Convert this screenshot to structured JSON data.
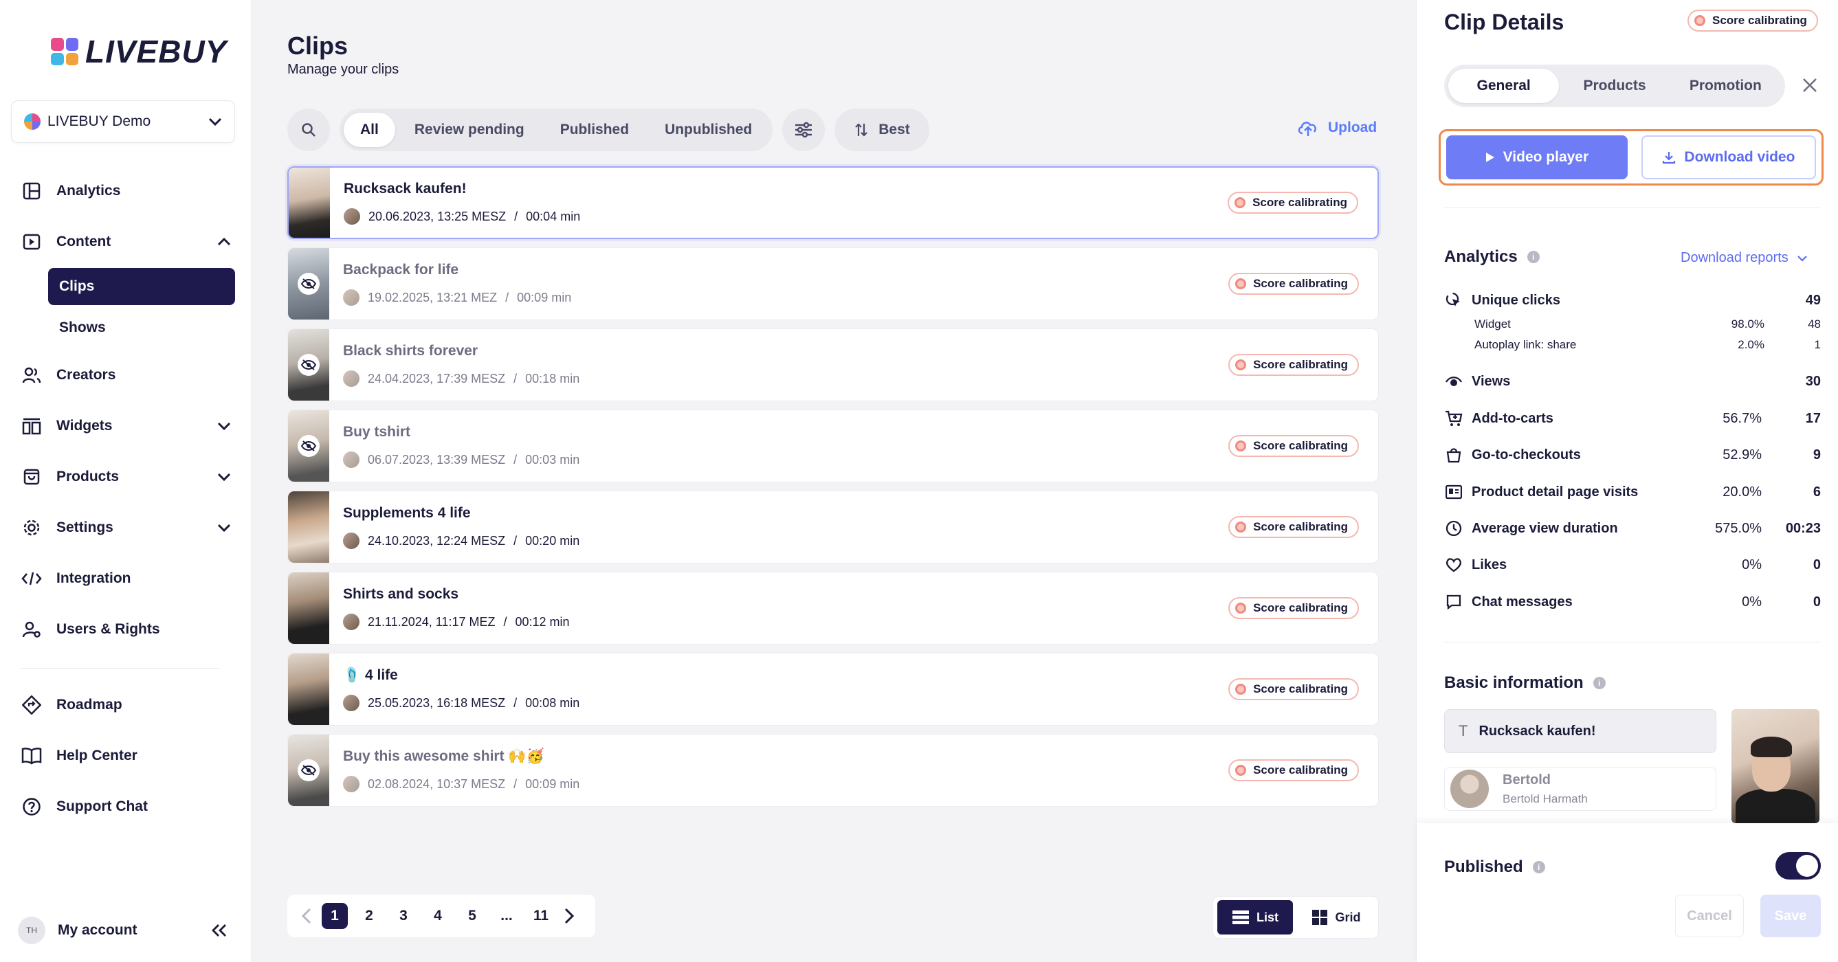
{
  "brand": {
    "name": "LIVEBUY"
  },
  "sidebar": {
    "org": "LIVEBUY Demo",
    "items": [
      {
        "label": "Analytics",
        "icon": "analytics-icon"
      },
      {
        "label": "Content",
        "icon": "content-icon"
      },
      {
        "label": "Creators",
        "icon": "creators-icon"
      },
      {
        "label": "Widgets",
        "icon": "widgets-icon"
      },
      {
        "label": "Products",
        "icon": "products-icon"
      },
      {
        "label": "Settings",
        "icon": "settings-icon"
      },
      {
        "label": "Integration",
        "icon": "code-icon"
      },
      {
        "label": "Users & Rights",
        "icon": "users-icon"
      },
      {
        "label": "Roadmap",
        "icon": "roadmap-icon"
      },
      {
        "label": "Help Center",
        "icon": "book-icon"
      },
      {
        "label": "Support Chat",
        "icon": "question-icon"
      }
    ],
    "sub_items": [
      {
        "label": "Clips"
      },
      {
        "label": "Shows"
      }
    ],
    "account": {
      "initials": "TH",
      "label": "My account"
    }
  },
  "main": {
    "title": "Clips",
    "subtitle": "Manage your clips",
    "filters": [
      "All",
      "Review pending",
      "Published",
      "Unpublished"
    ],
    "sort_label": "Best",
    "upload_label": "Upload",
    "clips": [
      {
        "title": "Rucksack kaufen!",
        "date": "20.06.2023, 13:25 MESZ",
        "sep": "/",
        "duration": "00:04 min",
        "badge": "Score calibrating"
      },
      {
        "title": "Backpack for life",
        "date": "19.02.2025, 13:21 MEZ",
        "sep": "/",
        "duration": "00:09 min",
        "badge": "Score calibrating"
      },
      {
        "title": "Black shirts forever",
        "date": "24.04.2023, 17:39 MESZ",
        "sep": "/",
        "duration": "00:18 min",
        "badge": "Score calibrating"
      },
      {
        "title": "Buy tshirt",
        "date": "06.07.2023, 13:39 MESZ",
        "sep": "/",
        "duration": "00:03 min",
        "badge": "Score calibrating"
      },
      {
        "title": "Supplements 4 life",
        "date": "24.10.2023, 12:24 MESZ",
        "sep": "/",
        "duration": "00:20 min",
        "badge": "Score calibrating"
      },
      {
        "title": "Shirts and socks",
        "date": "21.11.2024, 11:17 MEZ",
        "sep": "/",
        "duration": "00:12 min",
        "badge": "Score calibrating"
      },
      {
        "title": "🩴 4 life",
        "date": "25.05.2023, 16:18 MESZ",
        "sep": "/",
        "duration": "00:08 min",
        "badge": "Score calibrating"
      },
      {
        "title": "Buy this awesome shirt 🙌🥳",
        "date": "02.08.2024, 10:37 MESZ",
        "sep": "/",
        "duration": "00:09 min",
        "badge": "Score calibrating"
      }
    ],
    "pagination": [
      "1",
      "2",
      "3",
      "4",
      "5",
      "...",
      "11"
    ],
    "view": {
      "list": "List",
      "grid": "Grid"
    }
  },
  "panel": {
    "title": "Clip Details",
    "badge": "Score calibrating",
    "tabs": [
      "General",
      "Products",
      "Promotion"
    ],
    "video_player": "Video player",
    "download_video": "Download video",
    "analytics_title": "Analytics",
    "download_reports": "Download reports",
    "metrics": [
      {
        "label": "Unique clicks",
        "pct": "",
        "value": "49",
        "icon": "cursor-click-icon"
      },
      {
        "label": "Views",
        "pct": "",
        "value": "30",
        "icon": "eye-icon"
      },
      {
        "label": "Add-to-carts",
        "pct": "56.7%",
        "value": "17",
        "icon": "cart-icon"
      },
      {
        "label": "Go-to-checkouts",
        "pct": "52.9%",
        "value": "9",
        "icon": "bag-icon"
      },
      {
        "label": "Product detail page visits",
        "pct": "20.0%",
        "value": "6",
        "icon": "page-icon"
      },
      {
        "label": "Average view duration",
        "pct": "575.0%",
        "value": "00:23",
        "icon": "clock-icon"
      },
      {
        "label": "Likes",
        "pct": "0%",
        "value": "0",
        "icon": "heart-icon"
      },
      {
        "label": "Chat messages",
        "pct": "0%",
        "value": "0",
        "icon": "chat-icon"
      }
    ],
    "submetrics": [
      {
        "label": "Widget",
        "pct": "98.0%",
        "value": "48",
        "share": 0.98
      },
      {
        "label": "Autoplay link: share",
        "pct": "2.0%",
        "value": "1",
        "share": 0.02
      }
    ],
    "basic_title": "Basic information",
    "clip_name": "Rucksack kaufen!",
    "creator": {
      "name": "Bertold",
      "full": "Bertold Harmath"
    },
    "published_label": "Published",
    "published": true,
    "cancel": "Cancel",
    "save": "Save"
  },
  "colors": {
    "accent": "#1f1a4d",
    "primary": "#6e7cf5",
    "link": "#5b6cf0",
    "highlight": "#ed8a4a"
  }
}
